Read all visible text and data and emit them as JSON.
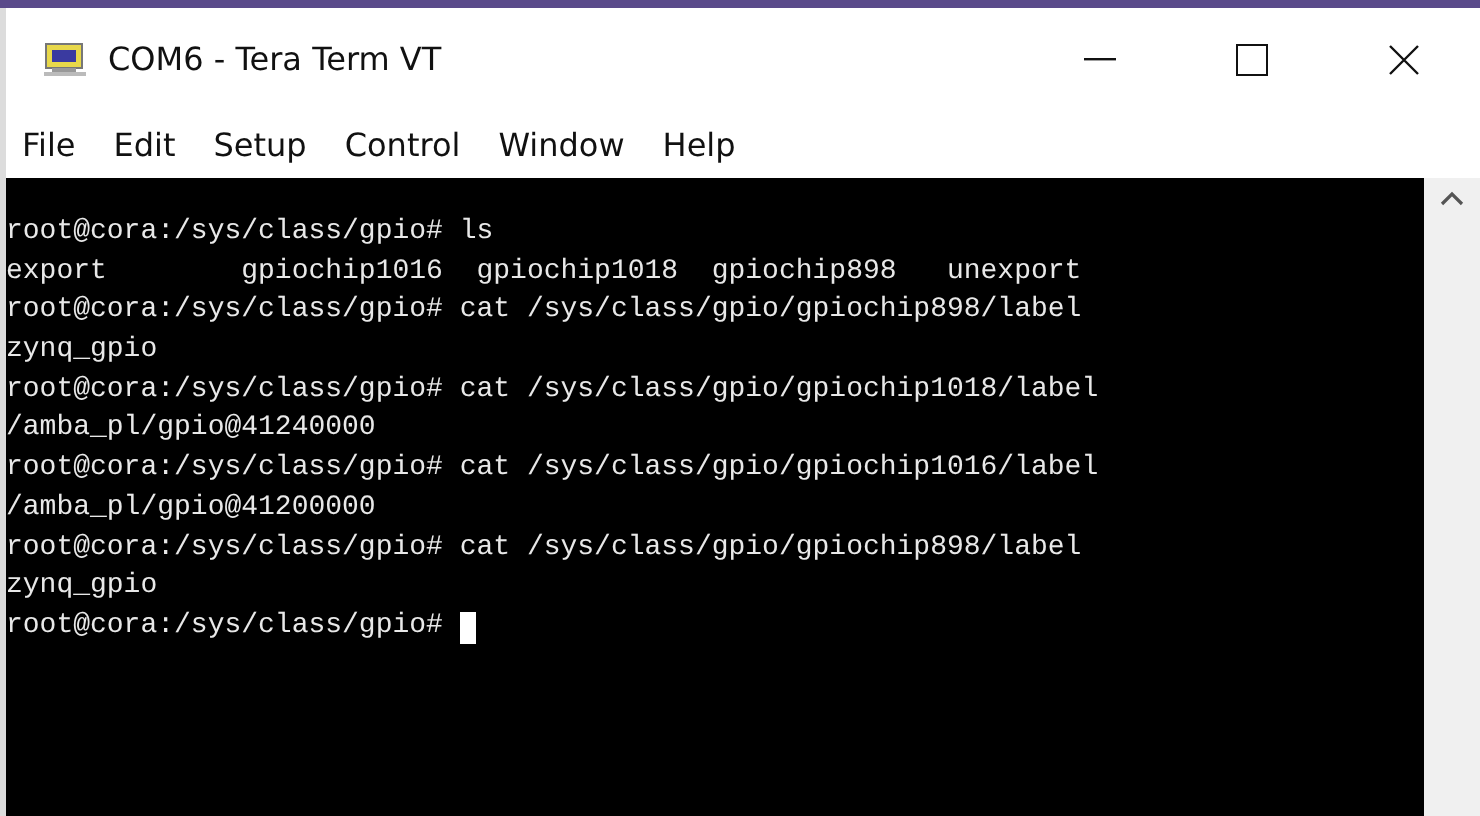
{
  "window": {
    "title": "COM6 - Tera Term VT"
  },
  "menu": [
    "File",
    "Edit",
    "Setup",
    "Control",
    "Window",
    "Help"
  ],
  "terminal": {
    "lines": [
      "root@cora:/sys/class/gpio# ls",
      "export        gpiochip1016  gpiochip1018  gpiochip898   unexport",
      "root@cora:/sys/class/gpio# cat /sys/class/gpio/gpiochip898/label",
      "zynq_gpio",
      "root@cora:/sys/class/gpio# cat /sys/class/gpio/gpiochip1018/label",
      "/amba_pl/gpio@41240000",
      "root@cora:/sys/class/gpio# cat /sys/class/gpio/gpiochip1016/label",
      "/amba_pl/gpio@41200000",
      "root@cora:/sys/class/gpio# cat /sys/class/gpio/gpiochip898/label",
      "zynq_gpio",
      "root@cora:/sys/class/gpio# "
    ],
    "cursor": true
  }
}
